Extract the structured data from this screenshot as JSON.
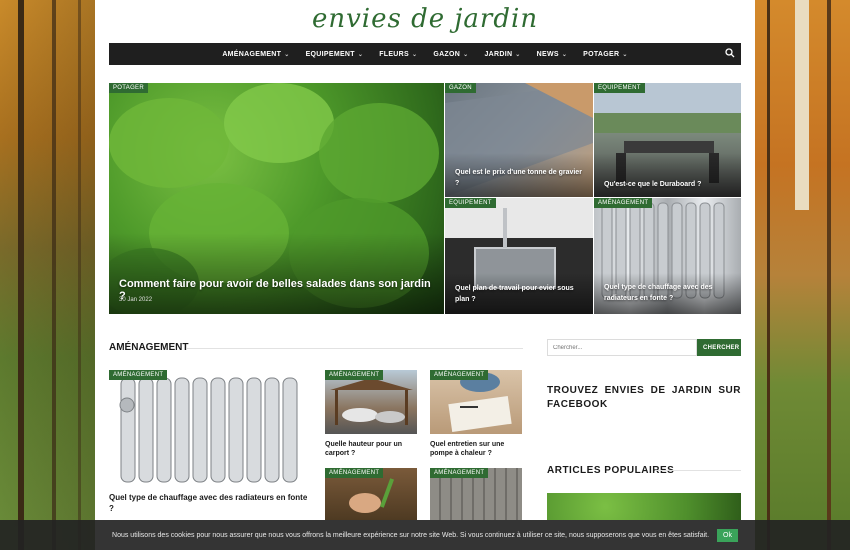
{
  "logo": {
    "text": "envies de jardin"
  },
  "nav": {
    "items": [
      {
        "label": "AMÉNAGEMENT"
      },
      {
        "label": "EQUIPEMENT"
      },
      {
        "label": "FLEURS"
      },
      {
        "label": "GAZON"
      },
      {
        "label": "JARDIN"
      },
      {
        "label": "NEWS"
      },
      {
        "label": "POTAGER"
      }
    ]
  },
  "featured": {
    "main": {
      "tag": "POTAGER",
      "title": "Comment faire pour avoir de belles salades dans son jardin ?",
      "date": "30 Jan 2022"
    },
    "t1": {
      "tag": "GAZON",
      "title": "Quel est le prix d'une tonne de gravier ?"
    },
    "t2": {
      "tag": "EQUIPEMENT",
      "title": "Qu'est-ce que le Duraboard ?"
    },
    "t3": {
      "tag": "EQUIPEMENT",
      "title": "Quel plan de travail pour evier sous plan ?"
    },
    "t4": {
      "tag": "AMÉNAGEMENT",
      "title": "Quel type de chauffage avec des radiateurs en fonte ?"
    }
  },
  "section": {
    "title": "AMÉNAGEMENT",
    "big": {
      "tag": "AMÉNAGEMENT",
      "title": "Quel type de chauffage avec des radiateurs en fonte ?"
    },
    "small": [
      {
        "tag": "AMÉNAGEMENT",
        "title": "Quelle hauteur pour un carport ?"
      },
      {
        "tag": "AMÉNAGEMENT",
        "title": "Quel entretien sur une pompe à chaleur ?"
      },
      {
        "tag": "AMÉNAGEMENT",
        "title": ""
      },
      {
        "tag": "AMÉNAGEMENT",
        "title": ""
      }
    ]
  },
  "sidebar": {
    "search_placeholder": "Chercher...",
    "search_button": "CHERCHER",
    "facebook_title": "TROUVEZ ENVIES DE JARDIN SUR FACEBOOK",
    "popular_title": "ARTICLES POPULAIRES"
  },
  "cookie": {
    "text": "Nous utilisons des cookies pour nous assurer que nous vous offrons la meilleure expérience sur notre site Web. Si vous continuez à utiliser ce site, nous supposerons que vous en êtes satisfait.",
    "ok": "Ok"
  },
  "colors": {
    "accent": "#2f6b32",
    "nav_bg": "#1f1f1f"
  }
}
